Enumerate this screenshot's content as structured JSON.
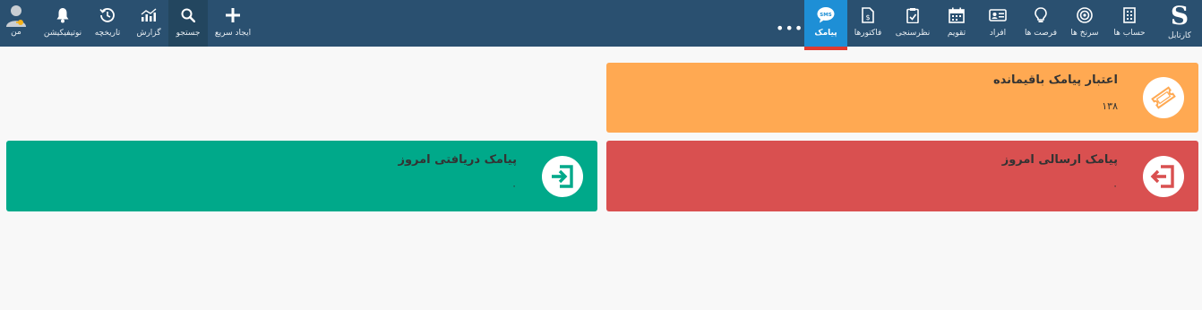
{
  "nav": {
    "right_items": [
      {
        "label": "کارتابل",
        "icon": "logo-s-icon"
      },
      {
        "label": "حساب ها",
        "icon": "building-icon"
      },
      {
        "label": "سرنخ ها",
        "icon": "target-icon"
      },
      {
        "label": "فرصت ها",
        "icon": "lightbulb-icon"
      },
      {
        "label": "افراد",
        "icon": "contact-card-icon"
      },
      {
        "label": "تقویم",
        "icon": "calendar-icon"
      },
      {
        "label": "نظرسنجی",
        "icon": "clipboard-icon"
      },
      {
        "label": "فاکتورها",
        "icon": "invoice-icon"
      },
      {
        "label": "پیامک",
        "icon": "sms-bubble-icon",
        "active": true
      }
    ],
    "more_label": "•••",
    "left_items": [
      {
        "label": "ایجاد سریع",
        "icon": "plus-icon"
      },
      {
        "label": "جستجو",
        "icon": "search-icon"
      },
      {
        "label": "گزارش",
        "icon": "chart-icon"
      },
      {
        "label": "تاریخچه",
        "icon": "history-icon"
      },
      {
        "label": "نوتیفیکیشن",
        "icon": "bell-icon"
      },
      {
        "label": "من",
        "icon": "user-avatar-icon"
      }
    ],
    "sms_icon_text": "SMS"
  },
  "cards": {
    "credit": {
      "title": "اعتبار پیامک باقیمانده",
      "value": "۱۳۸",
      "color": "#ffa952",
      "icon": "ticket-icon"
    },
    "sent": {
      "title": "پیامک ارسالی امروز",
      "value": "۰",
      "color": "#d95050",
      "icon": "sign-out-icon"
    },
    "received": {
      "title": "پیامک دریافتی امروز",
      "value": "۰",
      "color": "#00a98a",
      "icon": "sign-in-icon"
    }
  }
}
